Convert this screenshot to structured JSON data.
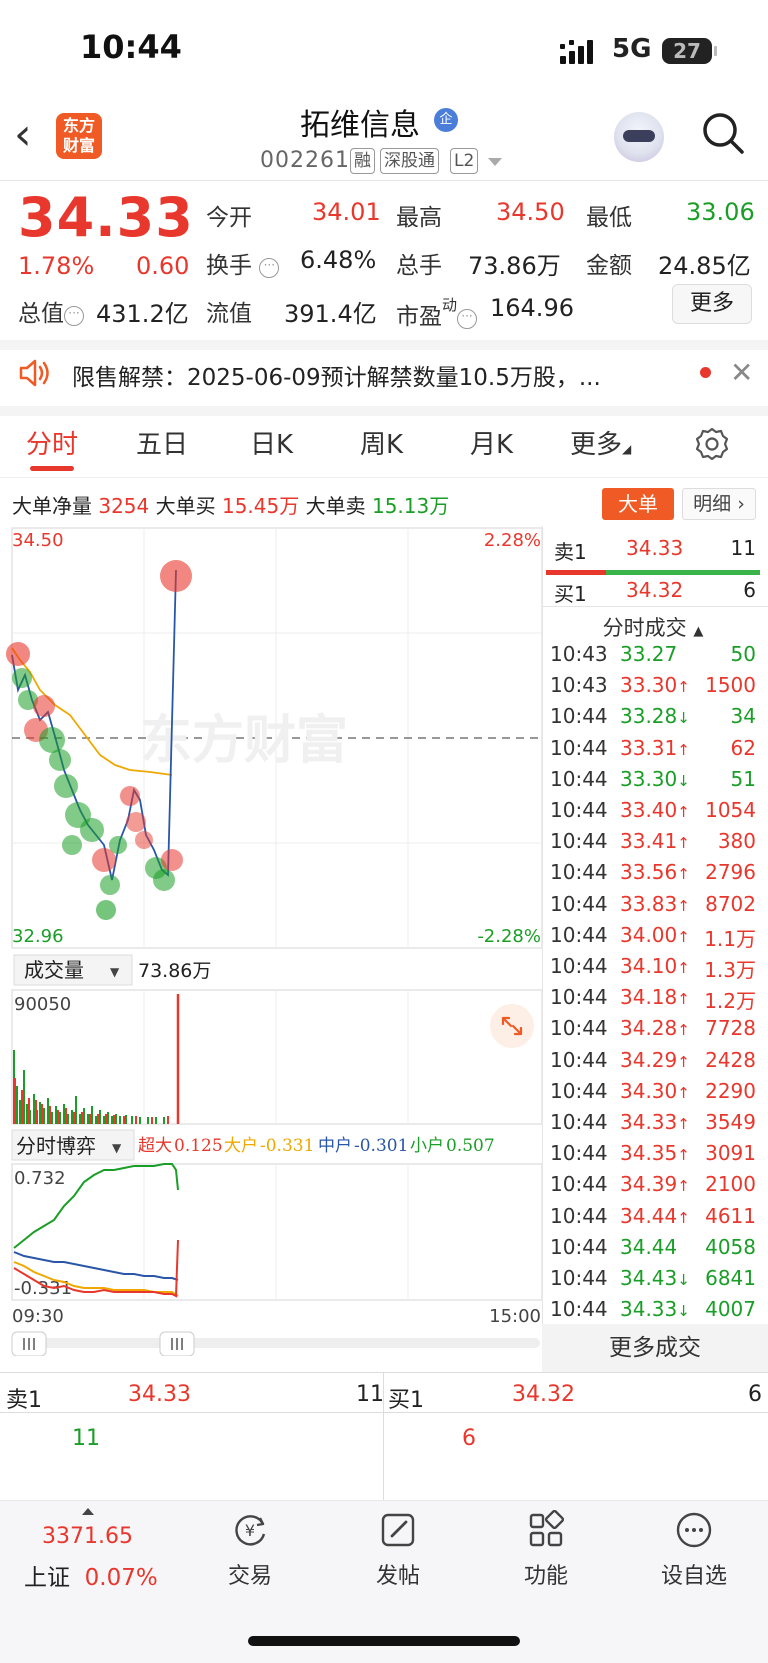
{
  "status_bar": {
    "time": "10:44",
    "network": "5G",
    "battery": "27"
  },
  "header": {
    "logo_text": "东方\n财富",
    "stock_name": "拓维信息",
    "badge": "企",
    "stock_code": "002261",
    "tags": [
      "融",
      "深股通",
      "L2"
    ]
  },
  "quote": {
    "price": "34.33",
    "change_pct": "1.78%",
    "change": "0.60",
    "fields": {
      "open_label": "今开",
      "open": "34.01",
      "high_label": "最高",
      "high": "34.50",
      "low_label": "最低",
      "low": "33.06",
      "turnover_label": "换手",
      "turnover": "6.48%",
      "volume_label": "总手",
      "volume": "73.86万",
      "amount_label": "金额",
      "amount": "24.85亿",
      "mcap_label": "总值",
      "mcap": "431.2亿",
      "float_label": "流值",
      "float_cap": "391.4亿",
      "pe_label": "市盈",
      "pe_sup": "动",
      "pe": "164.96"
    },
    "more_label": "更多"
  },
  "notice": {
    "text": "限售解禁：2025-06-09预计解禁数量10.5万股，..."
  },
  "tabs": [
    "分时",
    "五日",
    "日K",
    "周K",
    "月K",
    "更多"
  ],
  "big_order": {
    "net_label": "大单净量",
    "net": "3254",
    "buy_label": "大单买",
    "buy": "15.45万",
    "sell_label": "大单卖",
    "sell": "15.13万",
    "btn_dadan": "大单",
    "btn_mingxi": "明细"
  },
  "chart_data": {
    "type": "line",
    "y_max_label": "34.50",
    "y_min_label": "32.96",
    "pct_max_label": "2.28%",
    "pct_min_label": "-2.28%",
    "x_start": "09:30",
    "x_end": "15:00",
    "watermark": "东方财富",
    "volume_label": "成交量",
    "volume_total": "73.86万",
    "volume_max": "90050",
    "game_label": "分时博弈",
    "legend": [
      {
        "name": "超大",
        "value": "0.125",
        "color": "#e8372c"
      },
      {
        "name": "大户",
        "value": "-0.331",
        "color": "#f0a800"
      },
      {
        "name": "中户",
        "value": "-0.301",
        "color": "#2a56a8"
      },
      {
        "name": "小户",
        "value": "0.507",
        "color": "#1a9e27"
      }
    ],
    "game_max": "0.732",
    "game_min": "-0.331"
  },
  "order_book": {
    "sell1_label": "卖1",
    "sell1_price": "34.33",
    "sell1_vol": "11",
    "buy1_label": "买1",
    "buy1_price": "34.32",
    "buy1_vol": "6"
  },
  "trades_title": "分时成交",
  "trades": [
    {
      "time": "10:43",
      "price": "33.27",
      "dir": "",
      "vol": "50",
      "color": "green"
    },
    {
      "time": "10:43",
      "price": "33.30",
      "dir": "↑",
      "vol": "1500",
      "color": "red"
    },
    {
      "time": "10:44",
      "price": "33.28",
      "dir": "↓",
      "vol": "34",
      "color": "green"
    },
    {
      "time": "10:44",
      "price": "33.31",
      "dir": "↑",
      "vol": "62",
      "color": "red"
    },
    {
      "time": "10:44",
      "price": "33.30",
      "dir": "↓",
      "vol": "51",
      "color": "green"
    },
    {
      "time": "10:44",
      "price": "33.40",
      "dir": "↑",
      "vol": "1054",
      "color": "red"
    },
    {
      "time": "10:44",
      "price": "33.41",
      "dir": "↑",
      "vol": "380",
      "color": "red"
    },
    {
      "time": "10:44",
      "price": "33.56",
      "dir": "↑",
      "vol": "2796",
      "color": "red"
    },
    {
      "time": "10:44",
      "price": "33.83",
      "dir": "↑",
      "vol": "8702",
      "color": "red"
    },
    {
      "time": "10:44",
      "price": "34.00",
      "dir": "↑",
      "vol": "1.1万",
      "color": "red"
    },
    {
      "time": "10:44",
      "price": "34.10",
      "dir": "↑",
      "vol": "1.3万",
      "color": "red"
    },
    {
      "time": "10:44",
      "price": "34.18",
      "dir": "↑",
      "vol": "1.2万",
      "color": "red"
    },
    {
      "time": "10:44",
      "price": "34.28",
      "dir": "↑",
      "vol": "7728",
      "color": "red"
    },
    {
      "time": "10:44",
      "price": "34.29",
      "dir": "↑",
      "vol": "2428",
      "color": "red"
    },
    {
      "time": "10:44",
      "price": "34.30",
      "dir": "↑",
      "vol": "2290",
      "color": "red"
    },
    {
      "time": "10:44",
      "price": "34.33",
      "dir": "↑",
      "vol": "3549",
      "color": "red"
    },
    {
      "time": "10:44",
      "price": "34.35",
      "dir": "↑",
      "vol": "3091",
      "color": "red"
    },
    {
      "time": "10:44",
      "price": "34.39",
      "dir": "↑",
      "vol": "2100",
      "color": "red"
    },
    {
      "time": "10:44",
      "price": "34.44",
      "dir": "↑",
      "vol": "4611",
      "color": "red"
    },
    {
      "time": "10:44",
      "price": "34.44",
      "dir": "",
      "vol": "4058",
      "color": "green"
    },
    {
      "time": "10:44",
      "price": "34.43",
      "dir": "↓",
      "vol": "6841",
      "color": "green"
    },
    {
      "time": "10:44",
      "price": "34.33",
      "dir": "↓",
      "vol": "4007",
      "color": "green"
    }
  ],
  "more_trades": "更多成交",
  "bottom_book": {
    "sell_label": "卖1",
    "sell_price": "34.33",
    "sell_vol": "11",
    "sell_sub": "11",
    "buy_label": "买1",
    "buy_price": "34.32",
    "buy_vol": "6",
    "buy_sub": "6"
  },
  "bottom_nav": {
    "index_value": "3371.65",
    "index_name": "上证",
    "index_pct": "0.07%",
    "items": [
      "交易",
      "发帖",
      "功能",
      "设自选"
    ]
  }
}
